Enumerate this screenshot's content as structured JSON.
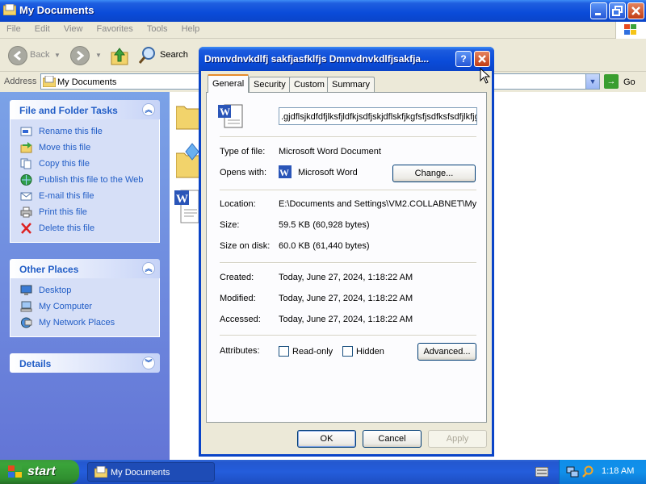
{
  "explorer": {
    "title": "My Documents",
    "menu": [
      "File",
      "Edit",
      "View",
      "Favorites",
      "Tools",
      "Help"
    ],
    "toolbar": {
      "back": "Back",
      "search": "Search"
    },
    "address": {
      "label": "Address",
      "value": "My Documents",
      "go": "Go"
    },
    "left_panels": {
      "tasks": {
        "title": "File and Folder Tasks",
        "items": [
          "Rename this file",
          "Move this file",
          "Copy this file",
          "Publish this file to the Web",
          "E-mail this file",
          "Print this file",
          "Delete this file"
        ]
      },
      "places": {
        "title": "Other Places",
        "items": [
          "Desktop",
          "My Computer",
          "My Network Places"
        ]
      },
      "details": {
        "title": "Details"
      }
    }
  },
  "dialog": {
    "title": "Dmnvdnvkdlfj sakfjasfklfjs Dmnvdnvkdlfjsakfja...",
    "tabs": [
      "General",
      "Security",
      "Custom",
      "Summary"
    ],
    "filename": ".gjdflsjkdfdfjlksfjldfkjsdfjskjdflskfjkgfsfjsdfksfsdfjlkfjgf",
    "type_label": "Type of file:",
    "type_value": "Microsoft Word Document",
    "opens_label": "Opens with:",
    "opens_value": "Microsoft Word",
    "change_button": "Change...",
    "location_label": "Location:",
    "location_value": "E:\\Documents and Settings\\VM2.COLLABNET\\My",
    "size_label": "Size:",
    "size_value": "59.5 KB (60,928 bytes)",
    "size_disk_label": "Size on disk:",
    "size_disk_value": "60.0 KB (61,440 bytes)",
    "created_label": "Created:",
    "created_value": "Today, June 27, 2024, 1:18:22 AM",
    "modified_label": "Modified:",
    "modified_value": "Today, June 27, 2024, 1:18:22 AM",
    "accessed_label": "Accessed:",
    "accessed_value": "Today, June 27, 2024, 1:18:22 AM",
    "attributes_label": "Attributes:",
    "readonly_label": "Read-only",
    "hidden_label": "Hidden",
    "advanced_button": "Advanced...",
    "ok_button": "OK",
    "cancel_button": "Cancel",
    "apply_button": "Apply"
  },
  "taskbar": {
    "start": "start",
    "task": "My Documents",
    "clock": "1:18 AM"
  },
  "colors": {
    "titlebar_blue": "#0a4bd9",
    "link_blue": "#215dc6",
    "start_green": "#3aa43a",
    "close_red": "#c13d14"
  }
}
